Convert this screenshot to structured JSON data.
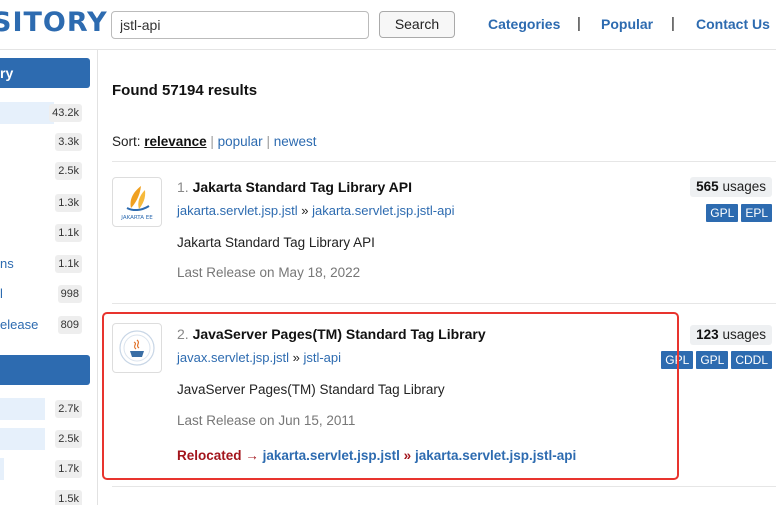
{
  "header": {
    "logo": "SITORY",
    "search_value": "jstl-api",
    "search_button": "Search",
    "nav": [
      {
        "label": "Categories"
      },
      {
        "label": "Popular"
      },
      {
        "label": "Contact Us"
      }
    ],
    "nav_separator": "|"
  },
  "sidebar": {
    "section1": {
      "title": "ry",
      "items": [
        {
          "label": "",
          "count": "43.2k",
          "fill": 0.6
        },
        {
          "label": "",
          "count": "3.3k",
          "fill": 0
        },
        {
          "label": "",
          "count": "2.5k",
          "fill": 0
        },
        {
          "label": "",
          "count": "1.3k",
          "fill": 0
        },
        {
          "label": "",
          "count": "1.1k",
          "fill": 0
        },
        {
          "label": "ns",
          "count": "1.1k",
          "fill": 0
        },
        {
          "label": "l",
          "count": "998",
          "fill": 0
        },
        {
          "label": "elease",
          "count": "809",
          "fill": 0
        }
      ]
    },
    "section2": {
      "title": "",
      "items": [
        {
          "count": "2.7k",
          "fill": 0.5
        },
        {
          "count": "2.5k",
          "fill": 0.5
        },
        {
          "count": "1.7k",
          "fill": 0.04
        },
        {
          "count": "1.5k",
          "fill": 0
        }
      ]
    }
  },
  "main": {
    "found": "Found 57194 results",
    "sort": {
      "label": "Sort:",
      "options": [
        "relevance",
        "popular",
        "newest"
      ],
      "selected": "relevance",
      "pipe": "|"
    },
    "results": [
      {
        "num": "1.",
        "title": "Jakarta Standard Tag Library API",
        "group": "jakarta.servlet.jsp.jstl",
        "artifact": "jakarta.servlet.jsp.jstl-api",
        "coord_sep": "»",
        "description": "Jakarta Standard Tag Library API",
        "release": "Last Release on May 18, 2022",
        "usages_count": "565",
        "usages_word": "usages",
        "licenses": [
          "GPL",
          "EPL"
        ],
        "logo_text": "JAKARTA EE",
        "icon": "jakarta-ee-logo-icon"
      },
      {
        "num": "2.",
        "title": "JavaServer Pages(TM) Standard Tag Library",
        "group": "javax.servlet.jsp.jstl",
        "artifact": "jstl-api",
        "coord_sep": "»",
        "description": "JavaServer Pages(TM) Standard Tag Library",
        "release": "Last Release on Jun 15, 2011",
        "usages_count": "123",
        "usages_word": "usages",
        "licenses": [
          "GPL",
          "GPL",
          "CDDL"
        ],
        "icon": "java-community-logo-icon",
        "relocated": {
          "word": "Relocated",
          "arrow": "→",
          "group": "jakarta.servlet.jsp.jstl",
          "sep": "»",
          "artifact": "jakarta.servlet.jsp.jstl-api"
        }
      }
    ]
  },
  "colors": {
    "brand": "#2d6bb0",
    "highlight": "#e8342e",
    "relocated": "#a3151c"
  }
}
